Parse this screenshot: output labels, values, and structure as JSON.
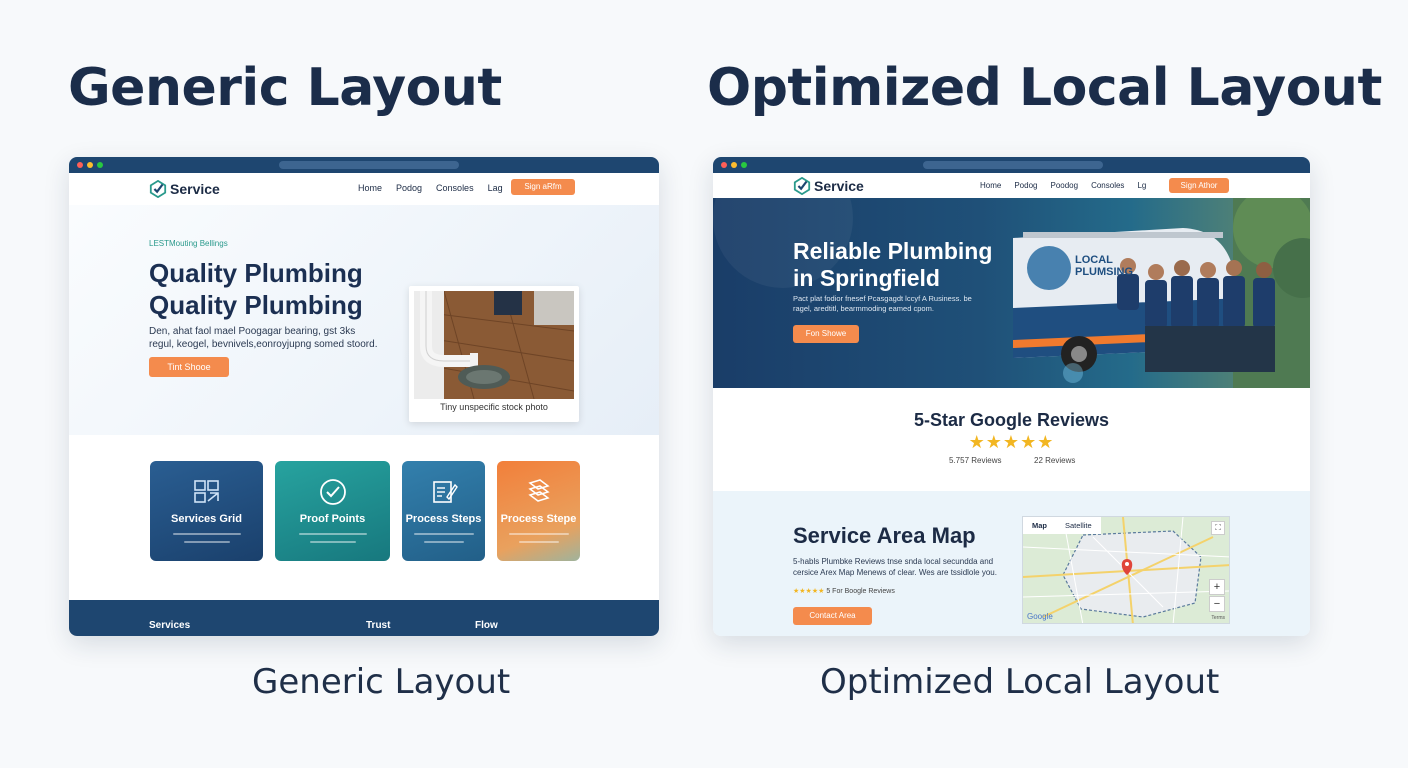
{
  "headings": {
    "left_title": "Generic Layout",
    "right_title": "Optimized Local Layout",
    "left_caption": "Generic Layout",
    "right_caption": "Optimized Local Layout"
  },
  "generic": {
    "brand": "Service",
    "nav": [
      "Home",
      "Podog",
      "Consoles",
      "Lag"
    ],
    "nav_button": "Sign aRfm",
    "hero_tag": "LESTMouting Bellings",
    "headline_1": "Quality Plumbing",
    "headline_2": "Quality Plumbing",
    "hero_text": "Den, ahat faol mael Poogagar bearing, gst 3ks regul, keogel, bevnivels,eonroyjupng somed stoord.",
    "hero_button": "Tint Shooe",
    "stock_caption": "Tiny unspecific stock photo",
    "tiles": [
      {
        "label": "Services Grid",
        "icon": "grid-icon",
        "color": "#1e4f80"
      },
      {
        "label": "Proof Points",
        "icon": "check-circle-icon",
        "color": "#1d8f8f"
      },
      {
        "label": "Process Steps",
        "icon": "edit-doc-icon",
        "color": "#2a6f98"
      },
      {
        "label": "Process Stepe",
        "icon": "layers-icon",
        "color": "#f28a46"
      }
    ],
    "footer": [
      "Services",
      "Trust",
      "Flow"
    ]
  },
  "optimized": {
    "brand": "Service",
    "nav": [
      "Home",
      "Podog",
      "Poodog",
      "Consoles",
      "Lg"
    ],
    "nav_button": "Sign Athor",
    "hero_line_1": "Reliable Plumbing",
    "hero_line_2": "in Springfield",
    "hero_sub": "Pact plat fodior fnesef Pcasgagdt lccyf A Rusiness. be ragel, aredtitl, bearmmoding eamed cpom.",
    "hero_button": "Fon Showe",
    "van_text_1": "LOCAL",
    "van_text_2": "PLUMSING",
    "reviews_title": "5-Star Google Reviews",
    "stars": "★★★★★",
    "review_count_1": "5.757 Reviews",
    "review_count_2": "22 Reviews",
    "map_title": "Service Area Map",
    "map_text": "5-habls Plumbke Reviews tnse snda local secundda and cersice Arex Map Menews of clear. Wes are tssidlole you.",
    "mini_stars": "★★★★★",
    "mini_text": "5 For Boogle Reviews",
    "map_button": "Contact Area",
    "map_tabs": [
      "Map",
      "Satellite"
    ],
    "zoom_in": "+",
    "zoom_out": "−",
    "google_label": "Google",
    "map_terms": "Terms"
  }
}
